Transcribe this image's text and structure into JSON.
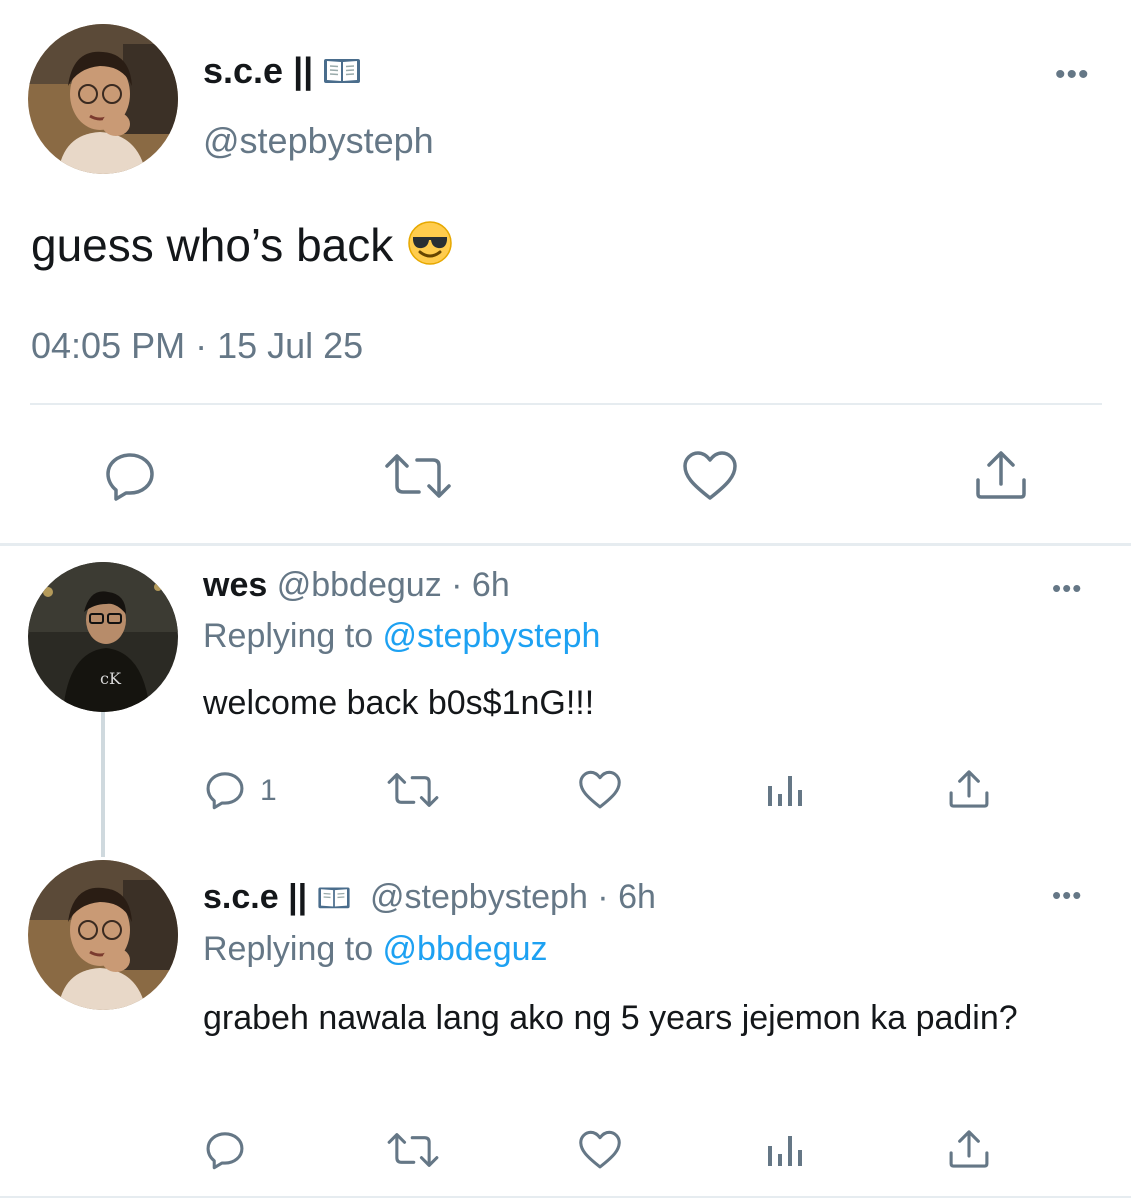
{
  "main_tweet": {
    "display_name": "s.c.e ||",
    "handle": "@stepbysteph",
    "text": "guess who’s back",
    "timestamp": "04:05 PM · 15 Jul 25",
    "more_label": "•••"
  },
  "replies": [
    {
      "display_name": "wes",
      "meta": "@bbdeguz · 6h",
      "replying_prefix": "Replying to ",
      "replying_to": "@stepbysteph",
      "text": "welcome back b0s$1nG!!!",
      "reply_count": "1",
      "more_label": "•••"
    },
    {
      "display_name": "s.c.e ||",
      "meta": "@stepbysteph · 6h",
      "replying_prefix": "Replying to ",
      "replying_to": "@bbdeguz",
      "text": "grabeh nawala lang ako ng 5 years jejemon ka padin?",
      "more_label": "•••"
    }
  ],
  "colors": {
    "text": "#14171a",
    "secondary": "#657786",
    "link": "#1da1f2",
    "divider": "#e6ecf0"
  },
  "icons": [
    "reply-icon",
    "retweet-icon",
    "like-icon",
    "share-icon",
    "analytics-icon",
    "more-icon",
    "open-book-icon",
    "sunglasses-emoji-icon"
  ]
}
